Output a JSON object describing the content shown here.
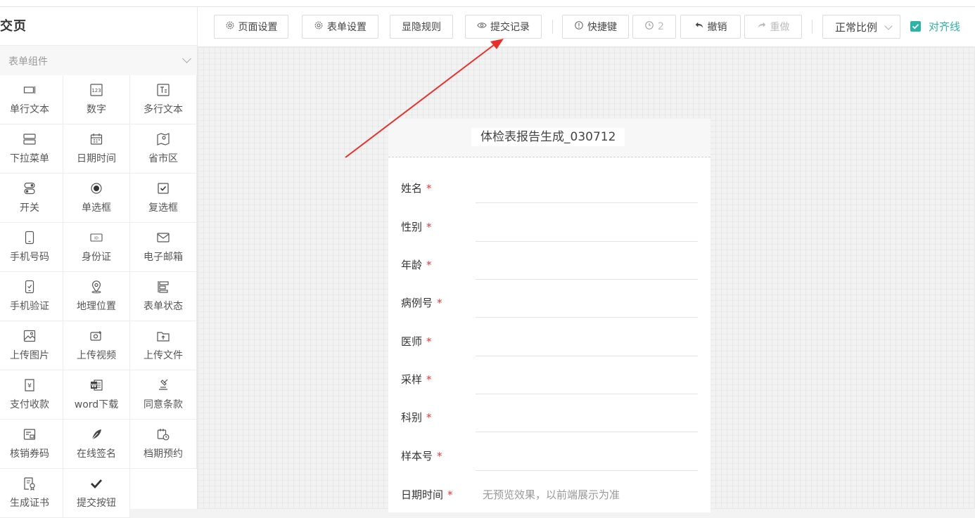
{
  "sidebar": {
    "title": "交页",
    "section_label": "表单组件",
    "components": [
      {
        "label": "单行文本",
        "icon": "single-line-text-icon"
      },
      {
        "label": "数字",
        "icon": "number-icon"
      },
      {
        "label": "多行文本",
        "icon": "multi-line-text-icon"
      },
      {
        "label": "下拉菜单",
        "icon": "dropdown-icon"
      },
      {
        "label": "日期时间",
        "icon": "calendar-icon"
      },
      {
        "label": "省市区",
        "icon": "map-region-icon"
      },
      {
        "label": "开关",
        "icon": "switch-icon"
      },
      {
        "label": "单选框",
        "icon": "radio-icon"
      },
      {
        "label": "复选框",
        "icon": "checkbox-icon"
      },
      {
        "label": "手机号码",
        "icon": "mobile-icon"
      },
      {
        "label": "身份证",
        "icon": "id-card-icon"
      },
      {
        "label": "电子邮箱",
        "icon": "email-icon"
      },
      {
        "label": "手机验证",
        "icon": "mobile-verify-icon"
      },
      {
        "label": "地理位置",
        "icon": "location-icon"
      },
      {
        "label": "表单状态",
        "icon": "form-status-icon"
      },
      {
        "label": "上传图片",
        "icon": "upload-image-icon"
      },
      {
        "label": "上传视频",
        "icon": "upload-video-icon"
      },
      {
        "label": "上传文件",
        "icon": "upload-file-icon"
      },
      {
        "label": "支付收款",
        "icon": "payment-icon"
      },
      {
        "label": "word下载",
        "icon": "word-icon"
      },
      {
        "label": "同意条款",
        "icon": "agree-terms-icon"
      },
      {
        "label": "核销券码",
        "icon": "coupon-icon"
      },
      {
        "label": "在线签名",
        "icon": "signature-icon"
      },
      {
        "label": "档期预约",
        "icon": "schedule-icon"
      },
      {
        "label": "生成证书",
        "icon": "certificate-icon"
      },
      {
        "label": "提交按钮",
        "icon": "check-icon"
      }
    ]
  },
  "toolbar": {
    "page_settings": "页面设置",
    "form_settings": "表单设置",
    "visibility_rules": "显隐规则",
    "submit_records": "提交记录",
    "shortcuts": "快捷键",
    "history_count": "2",
    "undo": "撤销",
    "redo": "重做",
    "zoom_select": "正常比例",
    "align_lines": "对齐线"
  },
  "form": {
    "title": "体检表报告生成_030712",
    "required_mark": "*",
    "fields": [
      {
        "label": "姓名",
        "required": true
      },
      {
        "label": "性别",
        "required": true
      },
      {
        "label": "年龄",
        "required": true
      },
      {
        "label": "病例号",
        "required": true
      },
      {
        "label": "医师",
        "required": true
      },
      {
        "label": "采样",
        "required": true
      },
      {
        "label": "科别",
        "required": true
      },
      {
        "label": "样本号",
        "required": true
      },
      {
        "label": "日期时间",
        "required": true,
        "placeholder": "无预览效果，以前端展示为准"
      }
    ]
  },
  "colors": {
    "accent": "#2fb3a6",
    "required": "#e33333",
    "arrow": "#e8302a"
  }
}
